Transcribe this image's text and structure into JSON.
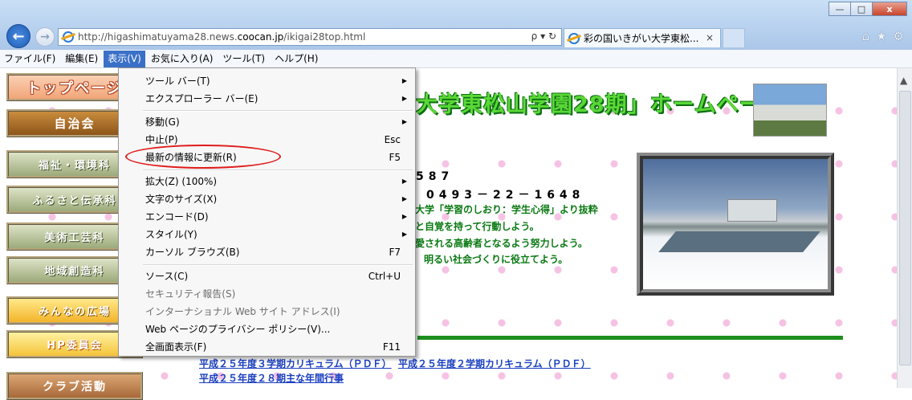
{
  "browser": {
    "url_prefix": "http://higashimatuyama28.news.",
    "url_domain": "coocan.jp",
    "url_suffix": "/ikigai28top.html",
    "addr_tools": "ρ ▾ ↻",
    "tab_title": "彩の国いきがい大学東松...",
    "tab_close": "×",
    "win_minimize": "—",
    "win_maximize": "□",
    "win_close": "x",
    "home": "⌂",
    "favorites": "★",
    "settings": "⚙"
  },
  "menubar": [
    {
      "label": "ファイル(F)"
    },
    {
      "label": "編集(E)"
    },
    {
      "label": "表示(V)",
      "active": true
    },
    {
      "label": "お気に入り(A)"
    },
    {
      "label": "ツール(T)"
    },
    {
      "label": "ヘルプ(H)"
    }
  ],
  "view_menu": {
    "items": [
      {
        "label": "ツール バー(T)",
        "sub": "▶"
      },
      {
        "label": "エクスプローラー バー(E)",
        "sub": "▶"
      },
      {
        "label": "移動(G)",
        "sub": "▶"
      },
      {
        "label": "中止(P)",
        "key": "Esc"
      },
      {
        "label": "最新の情報に更新(R)",
        "key": "F5"
      },
      {
        "label": "拡大(Z) (100%)",
        "sub": "▶"
      },
      {
        "label": "文字のサイズ(X)",
        "sub": "▶"
      },
      {
        "label": "エンコード(D)",
        "sub": "▶"
      },
      {
        "label": "スタイル(Y)",
        "sub": "▶"
      },
      {
        "label": "カーソル ブラウズ(B)",
        "key": "F7"
      },
      {
        "label": "ソース(C)",
        "key": "Ctrl+U"
      },
      {
        "label": "セキュリティ報告(S)"
      },
      {
        "label": "インターナショナル Web サイト アドレス(I)"
      },
      {
        "label": "Web ページのプライバシー ポリシー(V)..."
      },
      {
        "label": "全画面表示(F)",
        "key": "F11"
      }
    ]
  },
  "nav": [
    {
      "label": "トップページ"
    },
    {
      "label": "自治会"
    },
    {
      "label": "福祉・環境科"
    },
    {
      "label": "ふるさと伝承科"
    },
    {
      "label": "美術工芸科"
    },
    {
      "label": "地域創造科"
    },
    {
      "label": "みんなの広場"
    },
    {
      "label": "HP委員会"
    },
    {
      "label": "クラブ活動"
    }
  ],
  "page": {
    "title": "大学東松山学園28期」ホームページ",
    "address": "587",
    "tel": "0493－22－1648",
    "motto": [
      "大学「学習のしおり：学生心得」より抜粋",
      "と自覚を持って行動しよう。",
      "愛される高齢者となるよう努力しよう。",
      "明るい社会づくりに役立てよう。"
    ],
    "link_curriculum_3": "平成２５年度３学期カリキュラム（ＰＤＦ）",
    "link_curriculum_2": "平成２５年度２学期カリキュラム（ＰＤＦ）",
    "link_events": "平成２５年度２８期主な年間行事"
  },
  "colors": {
    "menu_active": "#3a70c8",
    "highlight_ring": "#e01b1b",
    "title_green": "#5ad836",
    "link_blue": "#1a3fc0"
  }
}
